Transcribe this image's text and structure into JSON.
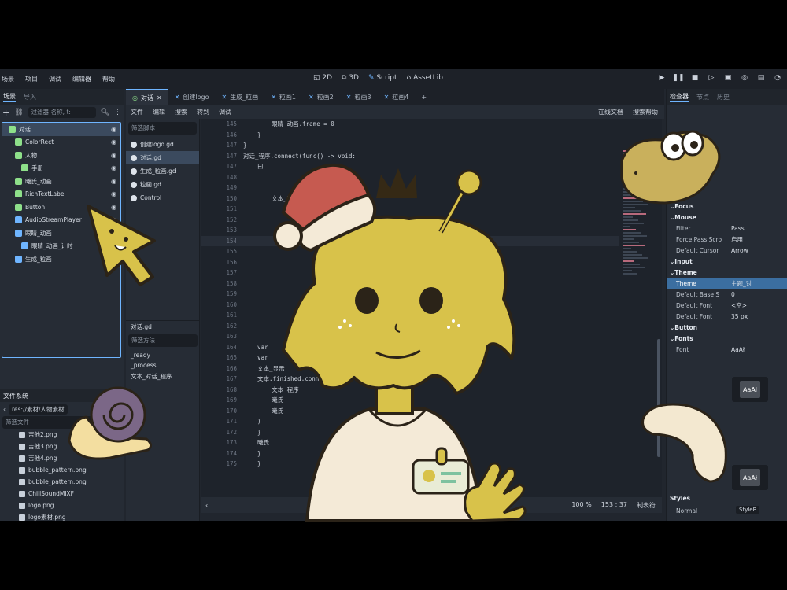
{
  "menubar": {
    "items": [
      "场景",
      "项目",
      "调试",
      "编辑器",
      "帮助"
    ],
    "workspaces": [
      {
        "label": "2D",
        "icon": "2d-icon"
      },
      {
        "label": "3D",
        "icon": "3d-icon"
      },
      {
        "label": "Script",
        "icon": "script-icon",
        "active": true
      },
      {
        "label": "AssetLib",
        "icon": "assetlib-icon"
      }
    ]
  },
  "scene_dock": {
    "tabs": [
      "场景",
      "导入"
    ],
    "filter_placeholder": "过滤器:名称, t:",
    "nodes": [
      {
        "label": "对话",
        "icon_color": "#8ee08a",
        "selected": true
      },
      {
        "label": "ColorRect",
        "icon_color": "#8ee08a"
      },
      {
        "label": "人物",
        "icon_color": "#8ee08a"
      },
      {
        "label": "手册",
        "icon_color": "#8ee08a"
      },
      {
        "label": "曦氏_动画",
        "icon_color": "#8ee08a"
      },
      {
        "label": "RichTextLabel",
        "icon_color": "#8ee08a"
      },
      {
        "label": "Button",
        "icon_color": "#8ee08a"
      },
      {
        "label": "AudioStreamPlayer",
        "icon_color": "#6fb5ff"
      },
      {
        "label": "眼睛_动画",
        "icon_color": "#6fb5ff"
      },
      {
        "label": "眼睛_动画_计时",
        "icon_color": "#6fb5ff"
      },
      {
        "label": "生成_粒画",
        "icon_color": "#6fb5ff"
      }
    ]
  },
  "filesystem": {
    "tab": "文件系统",
    "path": "res://素材/人物素材",
    "filter_placeholder": "筛选文件",
    "files": [
      "吉他2.png",
      "吉他3.png",
      "吉他4.png",
      "bubble_pattern.png",
      "bubble_pattern.png",
      "ChillSoundMIXF",
      "logo.png",
      "logo素材.png"
    ]
  },
  "script_tabs": [
    {
      "label": "对话",
      "active": true
    },
    {
      "label": "创建logo"
    },
    {
      "label": "生成_粒画"
    },
    {
      "label": "粒画1"
    },
    {
      "label": "粒画2"
    },
    {
      "label": "粒画3"
    },
    {
      "label": "粒画4"
    }
  ],
  "script_menu": {
    "items": [
      "文件",
      "编辑",
      "搜索",
      "转到",
      "调试"
    ],
    "right": [
      "在线文档",
      "搜索帮助"
    ]
  },
  "script_list": {
    "filter_placeholder": "筛选脚本",
    "items": [
      {
        "label": "创建logo.gd"
      },
      {
        "label": "对话.gd",
        "selected": true
      },
      {
        "label": "生成_粒画.gd"
      },
      {
        "label": "粒画.gd"
      },
      {
        "label": "Control"
      }
    ],
    "method_header": "对话.gd",
    "method_filter_placeholder": "筛选方法",
    "methods": [
      "_ready",
      "_process",
      "文本_对话_程序"
    ]
  },
  "code": {
    "lines": [
      {
        "n": "145",
        "text": "        眼睛_动画.frame = 0"
      },
      {
        "n": "146",
        "text": "    }"
      },
      {
        "n": "147",
        "text": "}"
      },
      {
        "n": "147",
        "text": "对话_程序.connect(func() -> void:"
      },
      {
        "n": "147",
        "text": "    曰"
      },
      {
        "n": "148",
        "text": ""
      },
      {
        "n": "149",
        "text": ""
      },
      {
        "n": "150",
        "text": "        文本_程序_size()"
      },
      {
        "n": "151",
        "text": ""
      },
      {
        "n": "152",
        "text": ""
      },
      {
        "n": "153",
        "text": ""
      },
      {
        "n": "154",
        "text": "",
        "current": true
      },
      {
        "n": "155",
        "text": ""
      },
      {
        "n": "156",
        "text": ""
      },
      {
        "n": "157",
        "text": ""
      },
      {
        "n": "158",
        "text": "                                          )"
      },
      {
        "n": "159",
        "text": ""
      },
      {
        "n": "160",
        "text": ""
      },
      {
        "n": "161",
        "text": ""
      },
      {
        "n": "162",
        "text": "                                        生成_粒画)"
      },
      {
        "n": "163",
        "text": ""
      },
      {
        "n": "164",
        "text": "    var                                  对话_生成_粒画"
      },
      {
        "n": "165",
        "text": "    var"
      },
      {
        "n": "166",
        "text": "    文本_显示"
      },
      {
        "n": "167",
        "text": "    文本.finished.connect("
      },
      {
        "n": "168",
        "text": "        文本_程序"
      },
      {
        "n": "169",
        "text": "        曦氏"
      },
      {
        "n": "170",
        "text": "        曦氏"
      },
      {
        "n": "171",
        "text": "    )"
      },
      {
        "n": "172",
        "text": "    }"
      },
      {
        "n": "173",
        "text": "    曦氏"
      },
      {
        "n": "174",
        "text": "    }"
      },
      {
        "n": "175",
        "text": "    }"
      }
    ]
  },
  "statusbar": {
    "zoom": "100 %",
    "position": "153 : 37",
    "indent": "制表符"
  },
  "inspector": {
    "tabs": [
      "检查器",
      "节点",
      "历史"
    ],
    "rows": [
      {
        "label": "Focus",
        "type": "head"
      },
      {
        "label": "Mouse",
        "type": "head"
      },
      {
        "label": "Filter",
        "value": "Pass"
      },
      {
        "label": "Force Pass Scro",
        "value": "启用"
      },
      {
        "label": "Default Cursor",
        "value": "Arrow"
      },
      {
        "label": "Input",
        "type": "head"
      },
      {
        "label": "Theme",
        "type": "head"
      },
      {
        "label": "Theme",
        "value": "主题_对",
        "type": "theme"
      },
      {
        "label": "Default Base S",
        "value": "0"
      },
      {
        "label": "Default Font",
        "value": "<空>"
      },
      {
        "label": "Default Font",
        "value": "35 px"
      },
      {
        "label": "Button",
        "type": "head"
      },
      {
        "label": "Fonts",
        "type": "head"
      },
      {
        "label": "Font",
        "value": "AaAł"
      }
    ],
    "styles_head": "Styles",
    "styles_row": {
      "label": "Normal",
      "value": "StyleB"
    },
    "font_preview": "AaAł"
  }
}
